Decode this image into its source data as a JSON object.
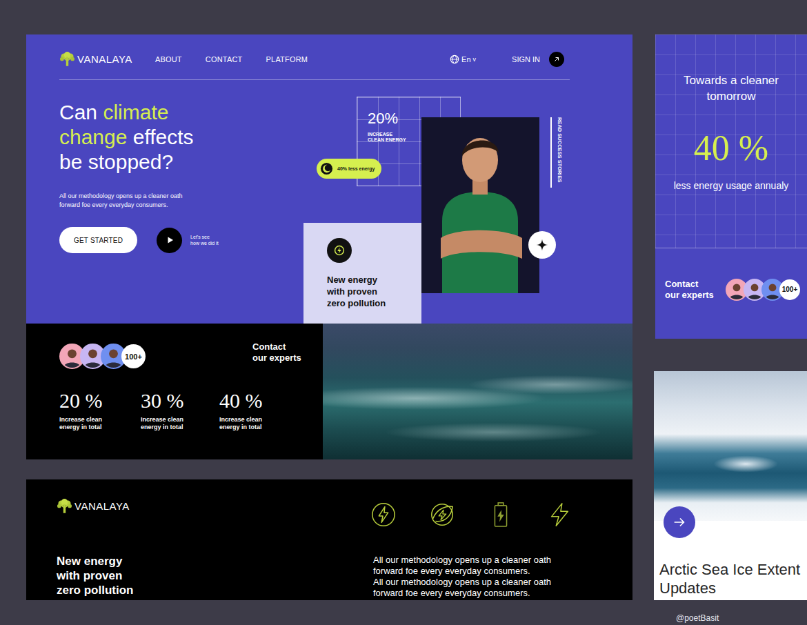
{
  "brand": "VANALAYA",
  "nav": {
    "links": [
      {
        "label": "ABOUT"
      },
      {
        "label": "CONTACT"
      },
      {
        "label": "PLATFORM"
      }
    ],
    "language": "En",
    "language_caret": "v",
    "sign_in": "SIGN IN"
  },
  "hero": {
    "title_start": "Can",
    "title_highlight": "climate change",
    "title_end": "effects be stopped?",
    "subtitle": "All our methodology opens up a cleaner oath forward foe every everyday consumers.",
    "cta": "GET STARTED",
    "video_caption": "Let's see how we did it",
    "stat_value": "20%",
    "stat_label": "INCREASE CLEAN ENERGY",
    "badge": "40% less energy",
    "side_link": "READ SUCCESS STORIES",
    "feature": "New energy with proven zero pollution"
  },
  "stats": {
    "avatars": [
      {
        "color": "#f3a6b8"
      },
      {
        "color": "#c7b6f3"
      },
      {
        "color": "#6f8ff0"
      }
    ],
    "more": "100+",
    "contact": "Contact our experts",
    "items": [
      {
        "value": "20 %",
        "label": "Increase clean energy in total"
      },
      {
        "value": "30 %",
        "label": "Increase clean energy in total"
      },
      {
        "value": "40 %",
        "label": "Increase clean energy in total"
      }
    ]
  },
  "footer": {
    "brand": "VANALAYA",
    "heading": "New energy with proven zero pollution",
    "paragraphs": [
      "All our methodology opens up a cleaner oath forward foe every everyday consumers.",
      "All our methodology opens up a cleaner oath forward foe every everyday consumers."
    ]
  },
  "side_card": {
    "title": "Towards a cleaner tomorrow",
    "value": "40 %",
    "caption": "less energy usage annualy",
    "contact": "Contact our experts",
    "avatars": [
      {
        "color": "#f3a6b8"
      },
      {
        "color": "#c7b6f3"
      },
      {
        "color": "#6f8ff0"
      }
    ],
    "more": "100+"
  },
  "article": {
    "title": "Arctic Sea Ice Extent Updates"
  },
  "credit": "@poetBasit"
}
